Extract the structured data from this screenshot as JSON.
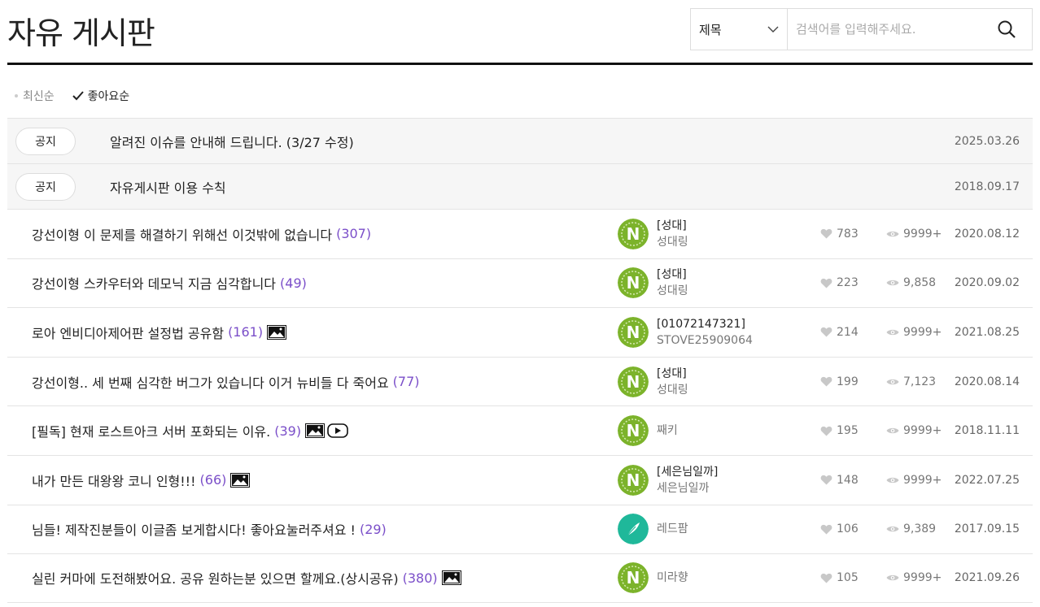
{
  "header": {
    "title": "자유 게시판",
    "search_select": "제목",
    "search_placeholder": "검색어를 입력해주세요."
  },
  "sort": {
    "latest": "최신순",
    "likes": "좋아요순"
  },
  "notices": [
    {
      "badge": "공지",
      "title": "알려진 이슈를 안내해 드립니다. (3/27 수정)",
      "date": "2025.03.26"
    },
    {
      "badge": "공지",
      "title": "자유게시판 이용 수칙",
      "date": "2018.09.17"
    }
  ],
  "posts": [
    {
      "title": "강선이형 이 문제를 해결하기 위해선 이것밖에 없습니다",
      "comments": "(307)",
      "nick": "[성대]",
      "sub": "성대링",
      "likes": "783",
      "views": "9999+",
      "date": "2020.08.12"
    },
    {
      "title": "강선이형 스카우터와 데모닉 지금 심각합니다",
      "comments": "(49)",
      "nick": "[성대]",
      "sub": "성대링",
      "likes": "223",
      "views": "9,858",
      "date": "2020.09.02"
    },
    {
      "title": "로아 엔비디아제어판 설정법 공유함",
      "comments": "(161)",
      "nick": "[01072147321]",
      "sub": "STOVE25909064",
      "likes": "214",
      "views": "9999+",
      "date": "2021.08.25"
    },
    {
      "title": "강선이형.. 세 번째 심각한 버그가 있습니다 이거 뉴비들 다 죽어요",
      "comments": "(77)",
      "nick": "[성대]",
      "sub": "성대링",
      "likes": "199",
      "views": "7,123",
      "date": "2020.08.14"
    },
    {
      "title": "[필독] 현재 로스트아크 서버 포화되는 이유.",
      "comments": "(39)",
      "nick": "",
      "sub": "째키",
      "likes": "195",
      "views": "9999+",
      "date": "2018.11.11"
    },
    {
      "title": "내가 만든 대왕왕 코니 인형!!!",
      "comments": "(66)",
      "nick": "[세은님일까]",
      "sub": "세은님일까",
      "likes": "148",
      "views": "9999+",
      "date": "2022.07.25"
    },
    {
      "title": "님들! 제작진분들이 이글좀 보게합시다! 좋아요눌러주셔요 !",
      "comments": "(29)",
      "nick": "",
      "sub": "레드팜",
      "likes": "106",
      "views": "9,389",
      "date": "2017.09.15"
    },
    {
      "title": "실린 커마에 도전해봤어요. 공유 원하는분 있으면 할께요.(상시공유)",
      "comments": "(380)",
      "nick": "",
      "sub": "미라향",
      "likes": "105",
      "views": "9999+",
      "date": "2021.09.26"
    }
  ],
  "colors": {
    "comment": "#7b4fc9",
    "avatar_green": "#7cb32b",
    "avatar_teal": "#1fb89a"
  }
}
